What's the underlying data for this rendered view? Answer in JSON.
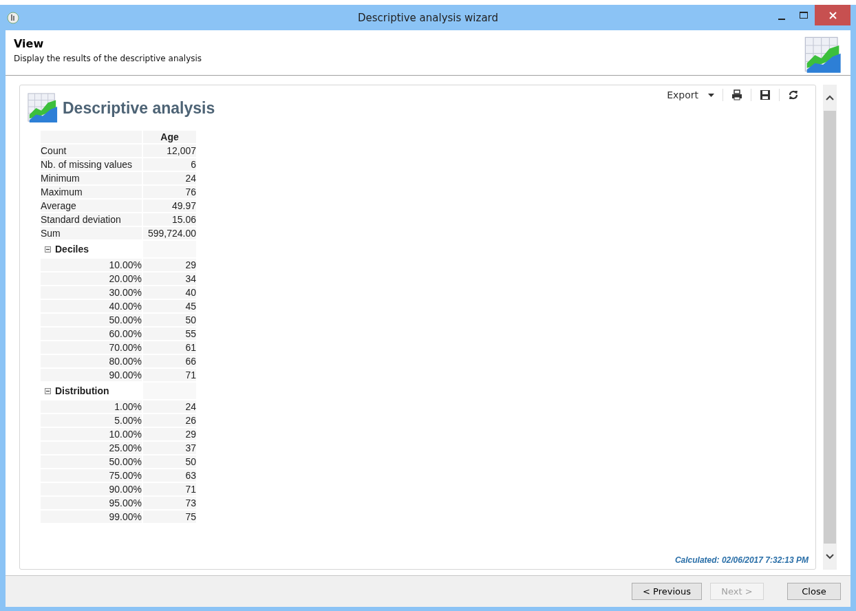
{
  "window": {
    "title": "Descriptive analysis wizard"
  },
  "header": {
    "title": "View",
    "subtitle": "Display the results of the descriptive analysis"
  },
  "report": {
    "title": "Descriptive analysis",
    "toolbar": {
      "export": "Export"
    },
    "column": "Age",
    "rows": [
      {
        "label": "Count",
        "value": "12,007"
      },
      {
        "label": "Nb. of missing values",
        "value": "6"
      },
      {
        "label": "Minimum",
        "value": "24"
      },
      {
        "label": "Maximum",
        "value": "76"
      },
      {
        "label": "Average",
        "value": "49.97"
      },
      {
        "label": "Standard deviation",
        "value": "15.06"
      },
      {
        "label": "Sum",
        "value": "599,724.00"
      }
    ],
    "sections": [
      {
        "title": "Deciles",
        "expanded": true,
        "rows": [
          {
            "label": "10.00%",
            "value": "29"
          },
          {
            "label": "20.00%",
            "value": "34"
          },
          {
            "label": "30.00%",
            "value": "40"
          },
          {
            "label": "40.00%",
            "value": "45"
          },
          {
            "label": "50.00%",
            "value": "50"
          },
          {
            "label": "60.00%",
            "value": "55"
          },
          {
            "label": "70.00%",
            "value": "61"
          },
          {
            "label": "80.00%",
            "value": "66"
          },
          {
            "label": "90.00%",
            "value": "71"
          }
        ]
      },
      {
        "title": "Distribution",
        "expanded": true,
        "rows": [
          {
            "label": "1.00%",
            "value": "24"
          },
          {
            "label": "5.00%",
            "value": "26"
          },
          {
            "label": "10.00%",
            "value": "29"
          },
          {
            "label": "25.00%",
            "value": "37"
          },
          {
            "label": "50.00%",
            "value": "50"
          },
          {
            "label": "75.00%",
            "value": "63"
          },
          {
            "label": "90.00%",
            "value": "71"
          },
          {
            "label": "95.00%",
            "value": "73"
          },
          {
            "label": "99.00%",
            "value": "75"
          }
        ]
      }
    ],
    "calculated": "Calculated: 02/06/2017 7:32:13 PM"
  },
  "buttons": [
    {
      "label": "< Previous",
      "disabled": false
    },
    {
      "label": "Next >",
      "disabled": true
    },
    {
      "label": "Close",
      "disabled": false
    }
  ]
}
